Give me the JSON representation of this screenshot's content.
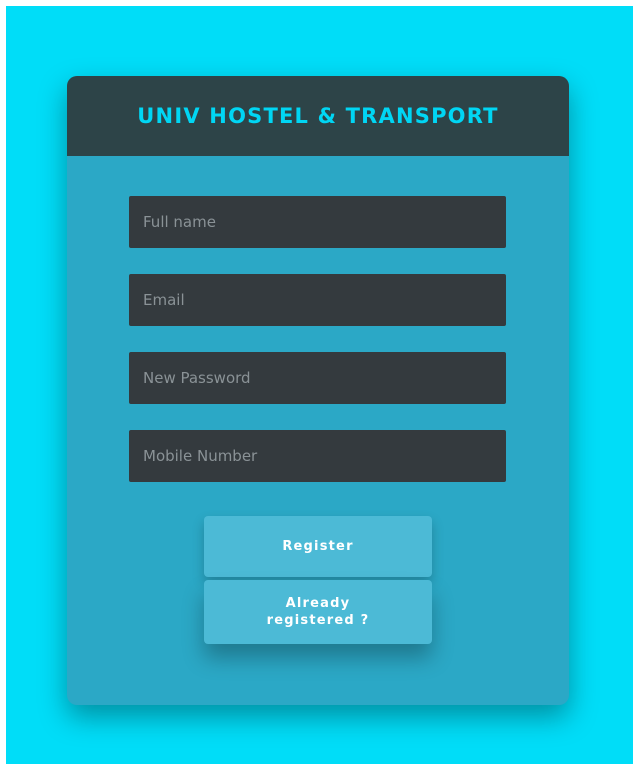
{
  "header": {
    "title": "UNIV HOSTEL & TRANSPORT"
  },
  "form": {
    "full_name": {
      "value": "",
      "placeholder": "Full name"
    },
    "email": {
      "value": "",
      "placeholder": "Email"
    },
    "password": {
      "value": "",
      "placeholder": "New Password"
    },
    "mobile": {
      "value": "",
      "placeholder": "Mobile Number"
    }
  },
  "buttons": {
    "register_label": "Register",
    "already_registered_label": "Already registered ?"
  },
  "colors": {
    "background": "#00ddf8",
    "card": "#2ba8c6",
    "header": "#2d4448",
    "title": "#00d6f4",
    "field": "#343a3e",
    "button": "#4cbad6"
  }
}
